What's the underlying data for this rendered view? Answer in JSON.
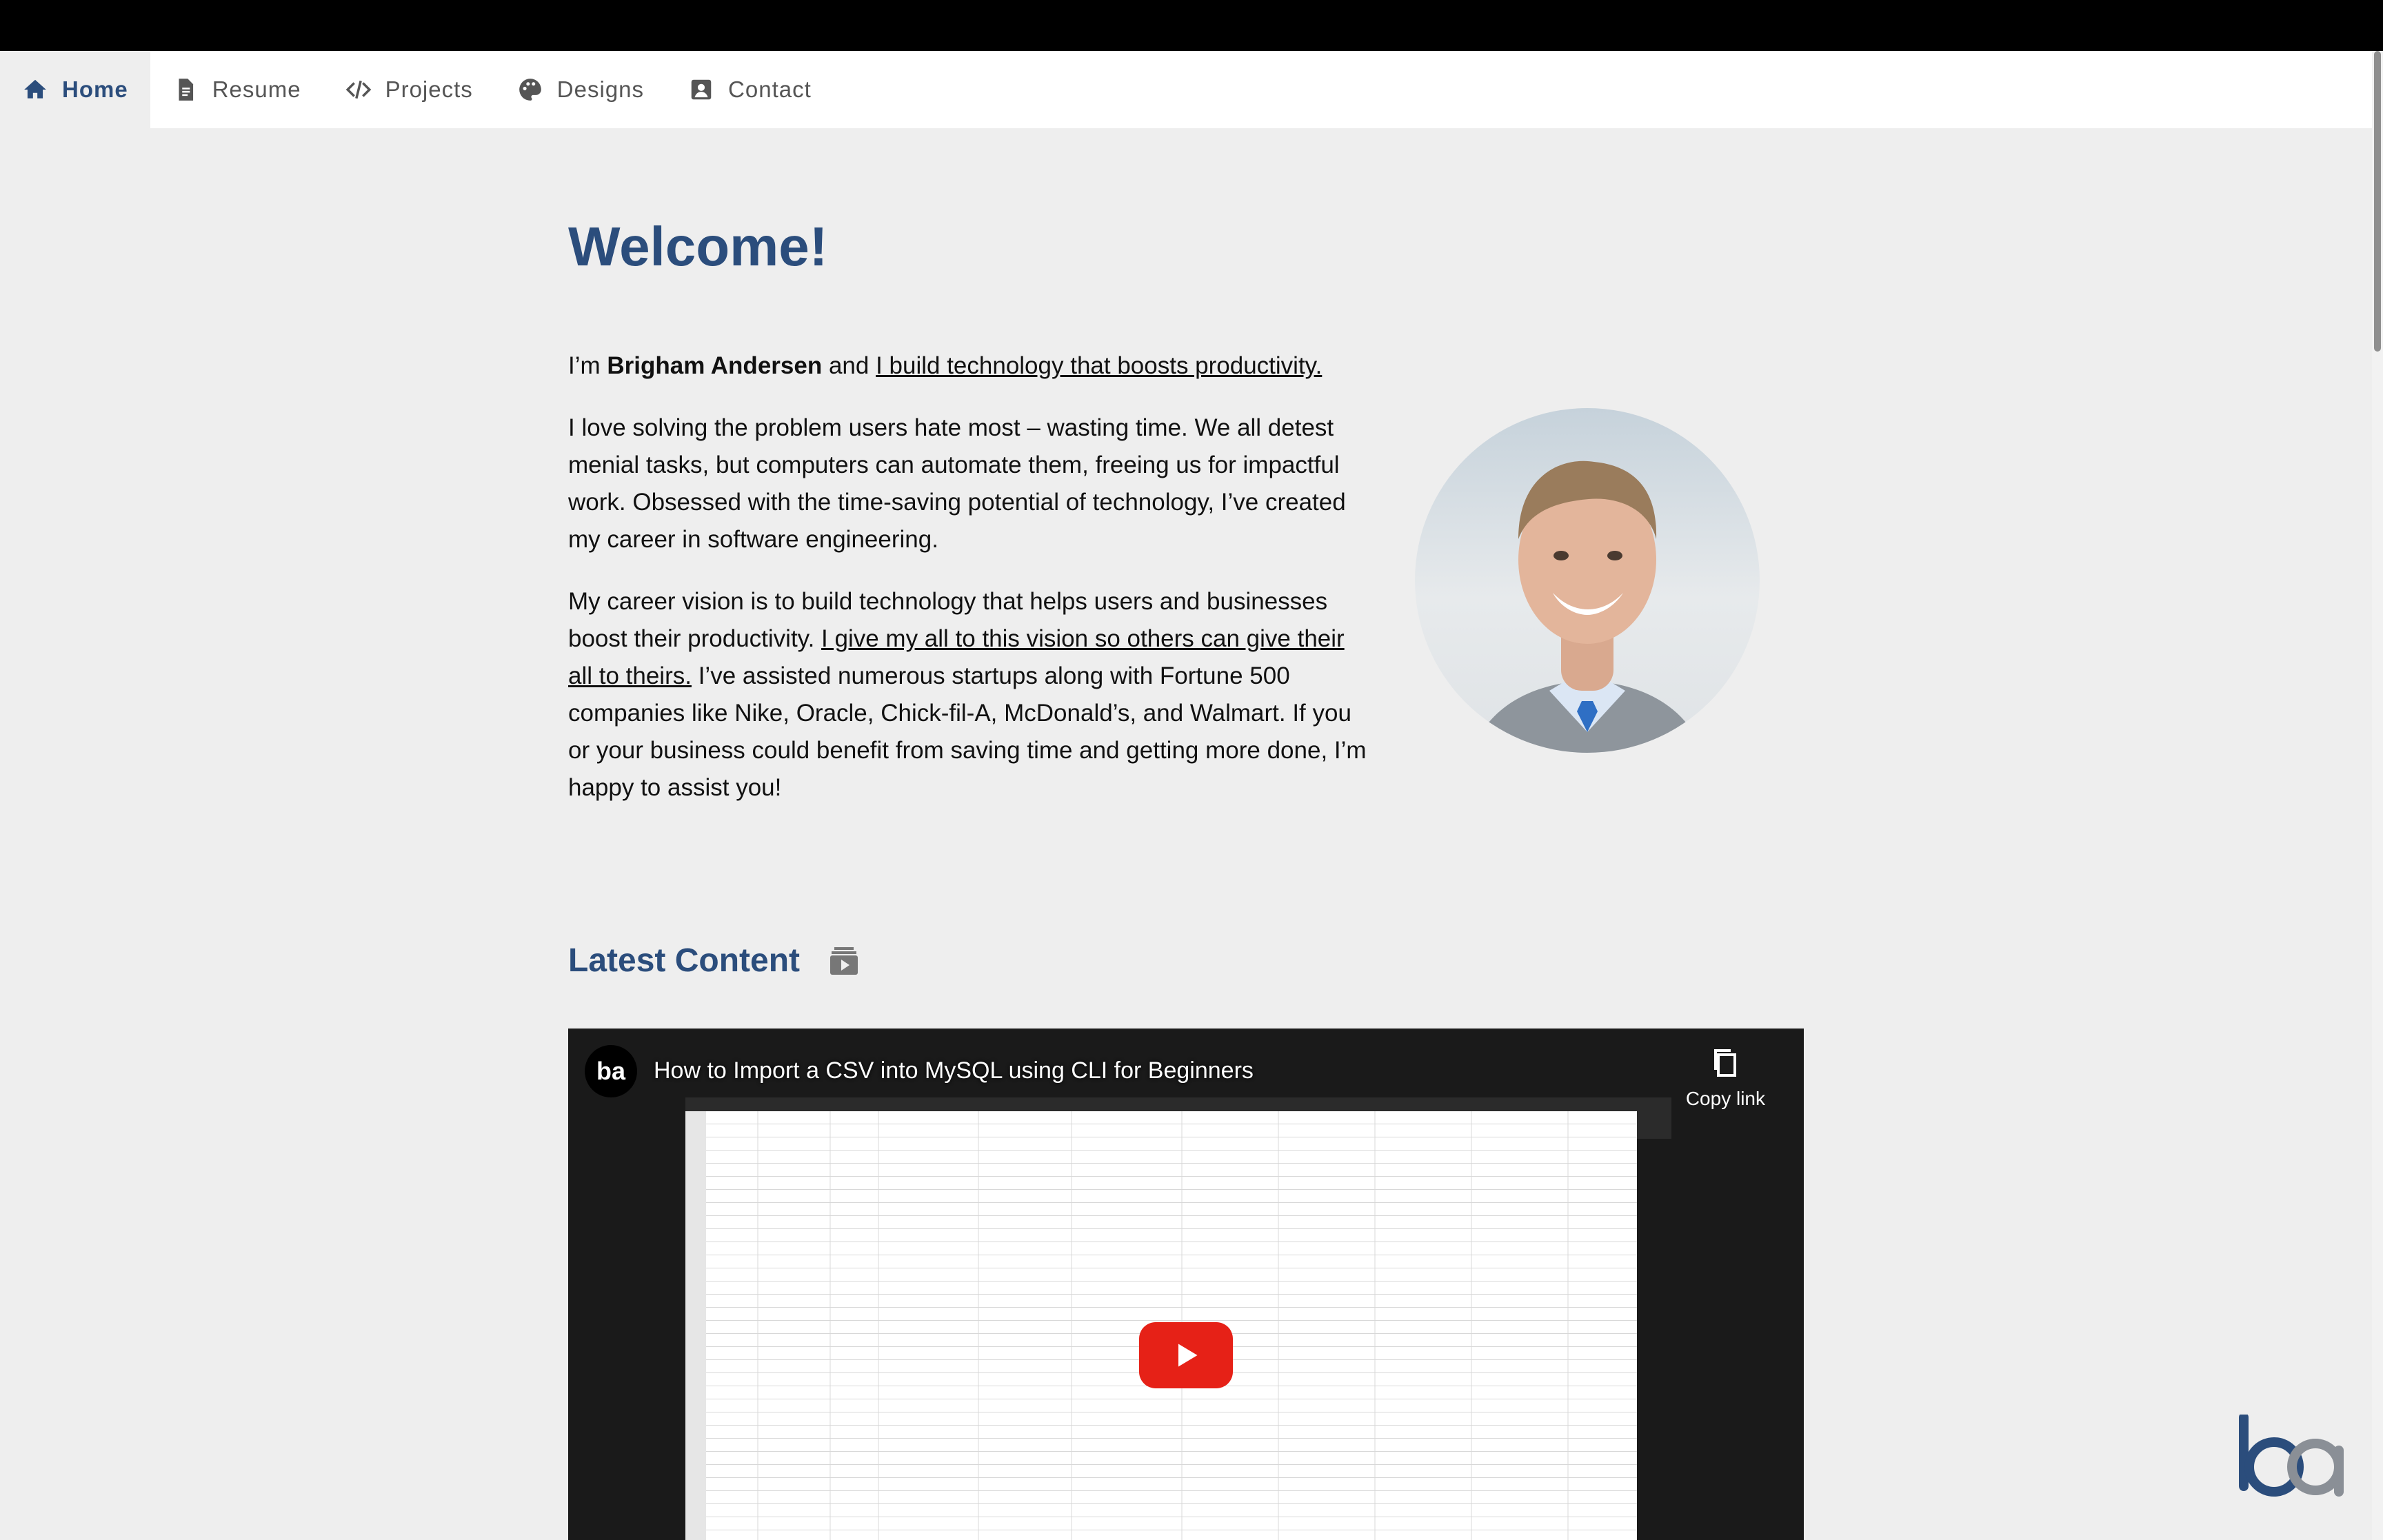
{
  "nav": {
    "items": [
      {
        "label": "Home",
        "icon": "home-icon",
        "active": true
      },
      {
        "label": "Resume",
        "icon": "document-icon"
      },
      {
        "label": "Projects",
        "icon": "code-icon"
      },
      {
        "label": "Designs",
        "icon": "palette-icon"
      },
      {
        "label": "Contact",
        "icon": "contact-card-icon"
      }
    ]
  },
  "page": {
    "title": "Welcome!",
    "intro": {
      "pre": "I’m ",
      "name": "Brigham Andersen",
      "mid": " and ",
      "link": "I build technology that boosts productivity."
    },
    "para1": "I love solving the problem users hate most – wasting time. We all detest menial tasks, but computers can automate them, freeing us for impactful work. Obsessed with the time-saving potential of technology, I’ve created my career in software engineering.",
    "para2": {
      "pre": "My career vision is to build technology that helps users and businesses boost their productivity. ",
      "link": "I give my all to this vision so others can give their all to theirs.",
      "post": " I’ve assisted numerous startups along with Fortune 500 companies like Nike, Oracle, Chick-fil-A, McDonald’s, and Walmart. If you or your business could benefit from saving time and getting more done, I’m happy to assist you!"
    }
  },
  "latest": {
    "title": "Latest Content",
    "icon": "video-stack-icon"
  },
  "video": {
    "title": "How to Import a CSV into MySQL using CLI for Beginners",
    "copy_label": "Copy link",
    "channel_logo_text": "ba",
    "play_icon": "play-icon"
  },
  "colors": {
    "accent": "#2b4d7c",
    "background": "#eeeeee",
    "play": "#e62117"
  }
}
